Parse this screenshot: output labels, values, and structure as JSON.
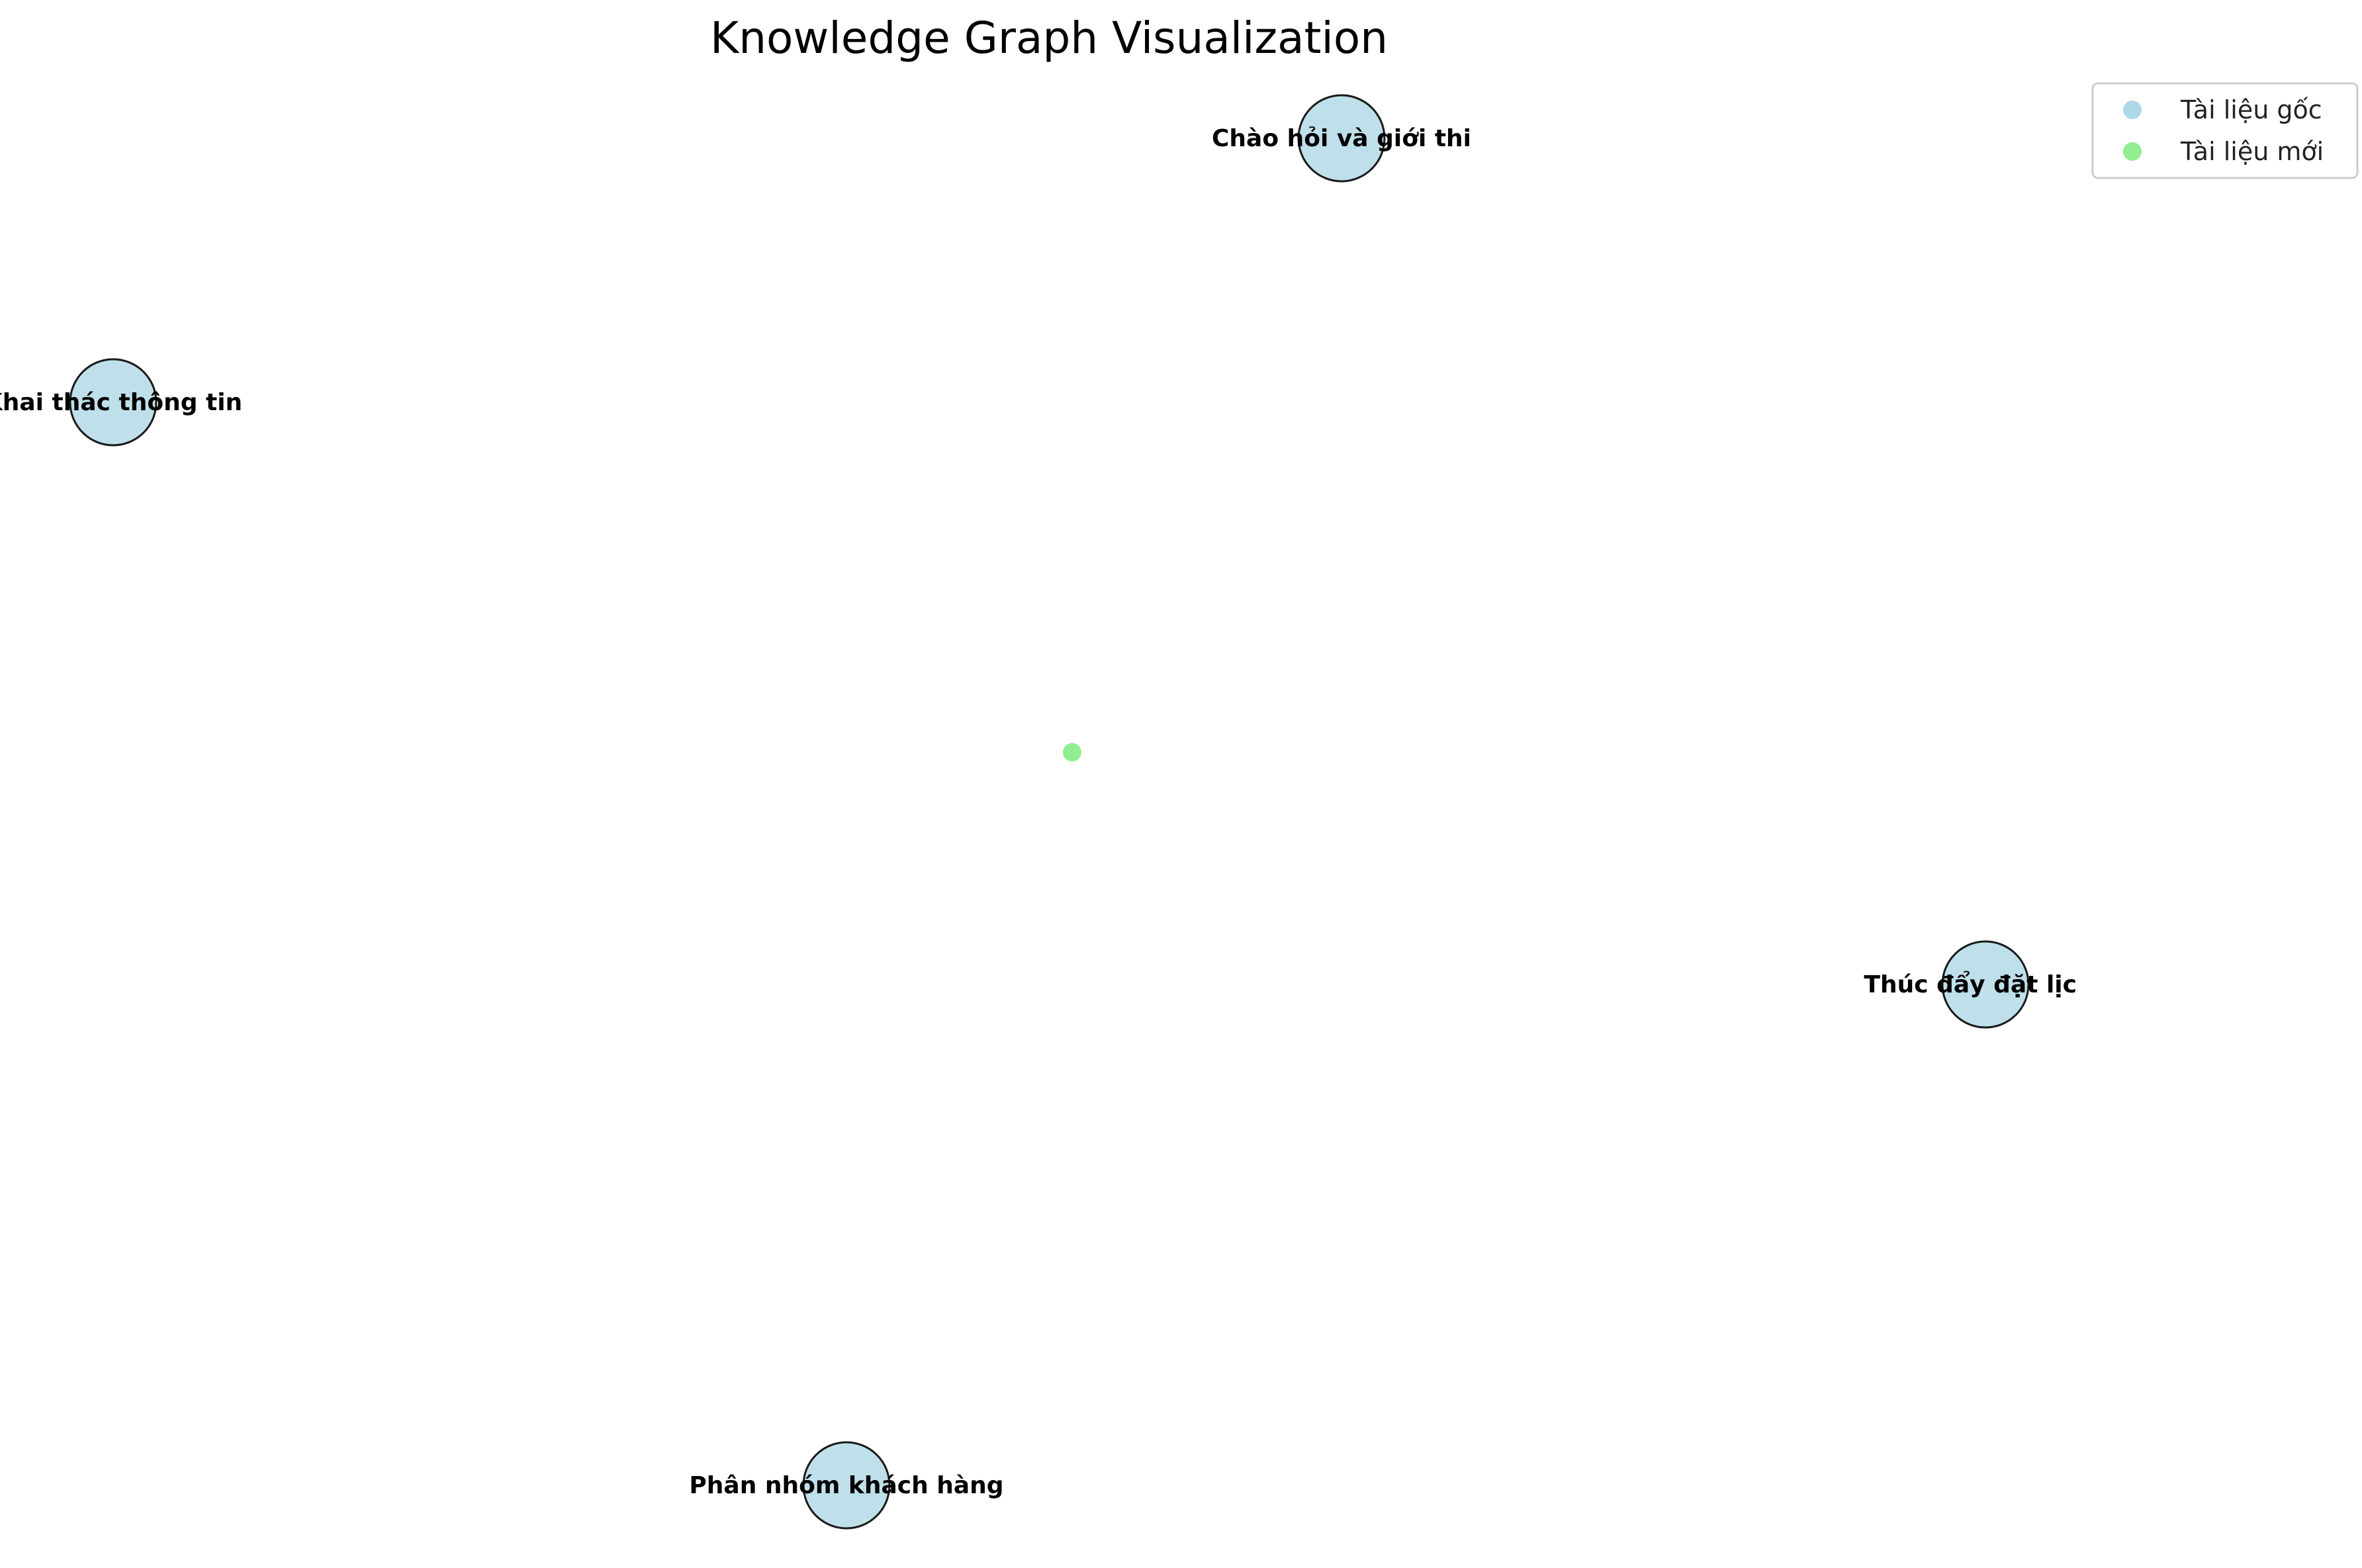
{
  "title": "Knowledge Graph Visualization",
  "legend": {
    "items": [
      {
        "label": "Tài liệu gốc",
        "color": "#add8e6"
      },
      {
        "label": "Tài liệu mới",
        "color": "#90ee90"
      }
    ]
  },
  "nodes": [
    {
      "id": "n1",
      "label": "Chào hỏi và giới thi",
      "group": "original"
    },
    {
      "id": "n2",
      "label": "Khai thác thông tin",
      "group": "original"
    },
    {
      "id": "n3",
      "label": "Thúc đẩy đặt lịch",
      "group": "original"
    },
    {
      "id": "n4",
      "label": "Phân nhóm khách hàng",
      "group": "original"
    },
    {
      "id": "n5",
      "label": "",
      "group": "new"
    }
  ],
  "colors": {
    "original_fill": "#bfe0ea",
    "original_stroke": "#1a1a1a",
    "new_fill": "#90ee90",
    "legend_border": "#cccccc"
  }
}
